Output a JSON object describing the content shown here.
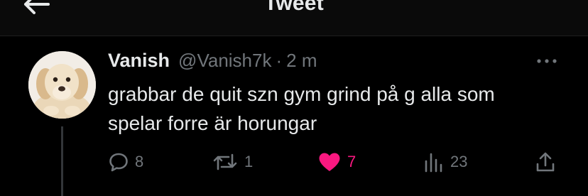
{
  "header": {
    "title": "Tweet"
  },
  "tweet": {
    "display_name": "Vanish",
    "handle": "@Vanish7k",
    "separator": "·",
    "time": "2 m",
    "text_lines": [
      "grabbar de quit szn gym grind på g alla som",
      "spelar forre är horungar"
    ]
  },
  "actions": {
    "replies": "8",
    "retweets": "1",
    "likes": "7",
    "views": "23"
  },
  "icons": {
    "back": "arrow-left-icon",
    "more": "more-dots-icon",
    "reply": "reply-bubble-icon",
    "retweet": "retweet-icon",
    "like": "heart-icon",
    "views": "views-bars-icon",
    "share": "share-icon"
  },
  "colors": {
    "background": "#000000",
    "text": "#e7e9ea",
    "secondary": "#71767b",
    "like": "#f91880"
  }
}
